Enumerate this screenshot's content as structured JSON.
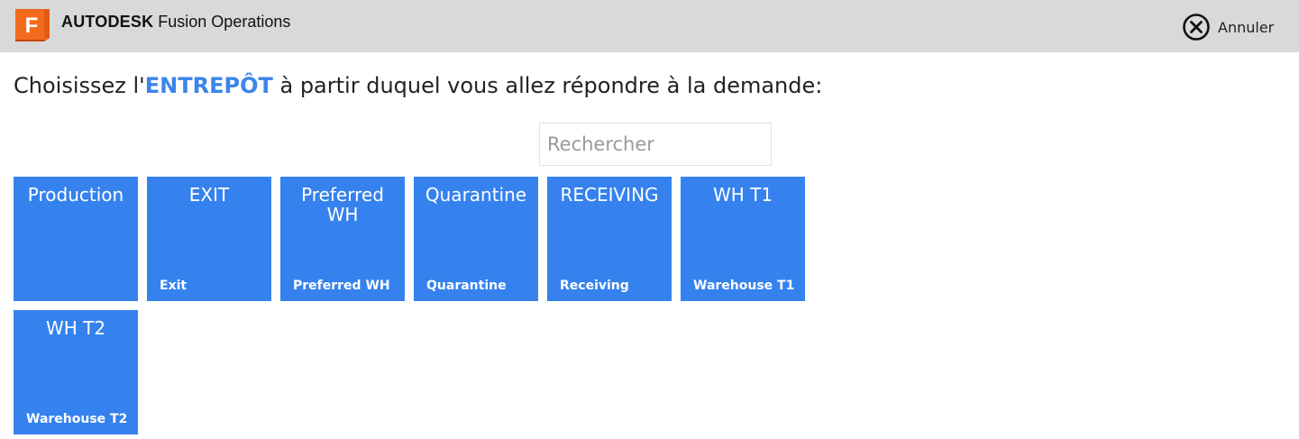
{
  "header": {
    "logo_letter": "F",
    "brand_vendor": "AUTODESK",
    "brand_product": "Fusion Operations",
    "cancel_label": "Annuler",
    "logo_icon": "autodesk-fusion-logo-icon",
    "cancel_icon": "close-circle-icon"
  },
  "prompt": {
    "before": "Choisissez l'",
    "emphasis": "ENTREPÔT",
    "after": " à partir duquel vous allez répondre à la demande:"
  },
  "search": {
    "placeholder": "Rechercher",
    "value": ""
  },
  "warehouses": [
    {
      "title": "Production",
      "subtitle": ""
    },
    {
      "title": "EXIT",
      "subtitle": "Exit"
    },
    {
      "title": "Preferred WH",
      "subtitle": "Preferred WH"
    },
    {
      "title": "Quarantine",
      "subtitle": "Quarantine"
    },
    {
      "title": "RECEIVING",
      "subtitle": "Receiving"
    },
    {
      "title": "WH T1",
      "subtitle": "Warehouse T1"
    },
    {
      "title": "WH T2",
      "subtitle": "Warehouse T2"
    }
  ],
  "colors": {
    "topbar": "#d9d9d9",
    "tile": "#3582ee",
    "accent": "#3a85ea",
    "logo_orange": "#f26b1d"
  }
}
